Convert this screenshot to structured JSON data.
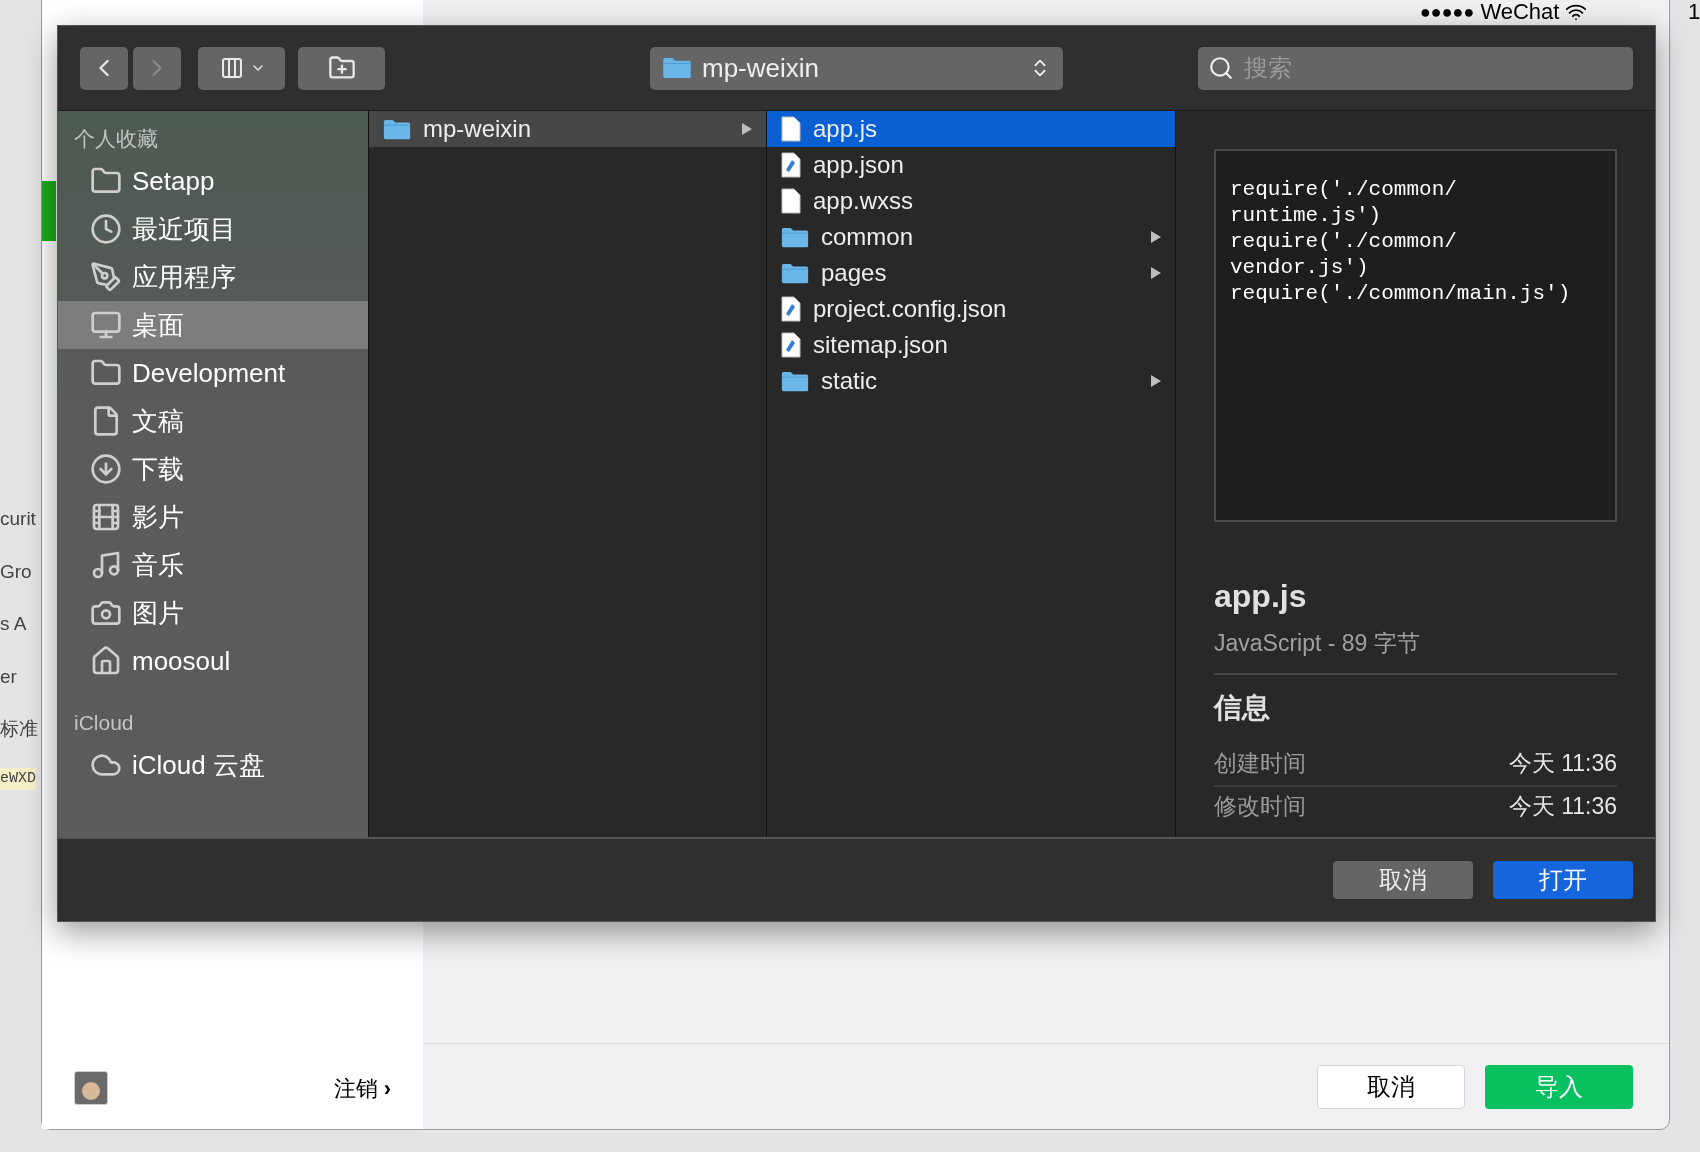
{
  "background": {
    "left_fragments": [
      "curit",
      "Gro",
      "s  A",
      "er",
      "标准",
      "eWXD"
    ],
    "status_bar": {
      "signal": "●●●●●",
      "carrier": "WeChat",
      "time": "1"
    }
  },
  "import_window": {
    "logout": "注销",
    "logout_arrow": "›",
    "buttons": [
      {
        "label": "取消",
        "kind": "secondary"
      },
      {
        "label": "导入",
        "kind": "primary"
      }
    ]
  },
  "dialog": {
    "nav": [
      {
        "kind": "back",
        "disabled": false
      },
      {
        "kind": "forward",
        "disabled": true
      }
    ],
    "location": "mp-weixin",
    "search": {
      "placeholder": "搜索"
    },
    "sidebar": [
      {
        "title": "个人收藏",
        "items": [
          {
            "label": "Setapp",
            "kind": "folder",
            "selected": false
          },
          {
            "label": "最近项目",
            "kind": "recents",
            "selected": false
          },
          {
            "label": "应用程序",
            "kind": "apps",
            "selected": false
          },
          {
            "label": "桌面",
            "kind": "desktop",
            "selected": true
          },
          {
            "label": "Development",
            "kind": "folder",
            "selected": false
          },
          {
            "label": "文稿",
            "kind": "documents",
            "selected": false
          },
          {
            "label": "下载",
            "kind": "downloads",
            "selected": false
          },
          {
            "label": "影片",
            "kind": "movies",
            "selected": false
          },
          {
            "label": "音乐",
            "kind": "music",
            "selected": false
          },
          {
            "label": "图片",
            "kind": "pictures",
            "selected": false
          },
          {
            "label": "moosoul",
            "kind": "home",
            "selected": false
          }
        ]
      },
      {
        "title": "iCloud",
        "items": [
          {
            "label": "iCloud 云盘",
            "kind": "cloud",
            "selected": false
          }
        ]
      }
    ],
    "columns": [
      [
        {
          "name": "mp-weixin",
          "kind": "folder",
          "selected": true,
          "has_children": true
        }
      ],
      [
        {
          "name": "app.js",
          "kind": "file",
          "selected": true,
          "has_children": false
        },
        {
          "name": "app.json",
          "kind": "json",
          "selected": false,
          "has_children": false
        },
        {
          "name": "app.wxss",
          "kind": "file",
          "selected": false,
          "has_children": false
        },
        {
          "name": "common",
          "kind": "folder",
          "selected": false,
          "has_children": true
        },
        {
          "name": "pages",
          "kind": "folder",
          "selected": false,
          "has_children": true
        },
        {
          "name": "project.config.json",
          "kind": "json",
          "selected": false,
          "has_children": false
        },
        {
          "name": "sitemap.json",
          "kind": "json",
          "selected": false,
          "has_children": false
        },
        {
          "name": "static",
          "kind": "folder",
          "selected": false,
          "has_children": true
        }
      ]
    ],
    "preview": {
      "code_lines": [
        "require('./common/",
        "runtime.js')",
        "require('./common/",
        "vendor.js')",
        "require('./common/main.js')"
      ],
      "name": "app.js",
      "subtitle": "JavaScript - 89 字节",
      "info_title": "信息",
      "info": [
        {
          "label": "创建时间",
          "value": "今天 11:36"
        },
        {
          "label": "修改时间",
          "value": "今天 11:36"
        }
      ]
    },
    "buttons": [
      {
        "label": "取消",
        "kind": "secondary"
      },
      {
        "label": "打开",
        "kind": "primary"
      }
    ]
  }
}
